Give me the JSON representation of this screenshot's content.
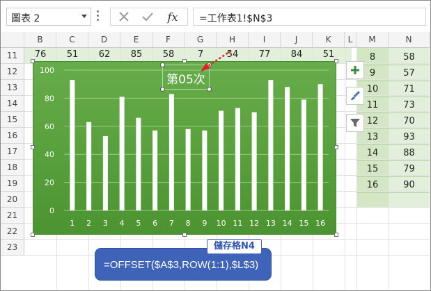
{
  "name_box": {
    "value": "圖表 2"
  },
  "formula_bar": {
    "fx_label": "fx",
    "formula": "=工作表1!$N$3"
  },
  "columns": [
    "B",
    "C",
    "D",
    "E",
    "F",
    "G",
    "H",
    "I",
    "J",
    "K",
    "L",
    "M",
    "N"
  ],
  "rows": [
    "11",
    "12",
    "13",
    "14",
    "15",
    "16",
    "17",
    "18",
    "19",
    "20",
    "21",
    "22",
    "23"
  ],
  "row10_partial": [
    "76",
    "51",
    "62",
    "85",
    "58",
    "7",
    "54",
    "77",
    "84",
    "51"
  ],
  "mn_table": [
    {
      "m": "8",
      "n": "58"
    },
    {
      "m": "9",
      "n": "57"
    },
    {
      "m": "10",
      "n": "71"
    },
    {
      "m": "11",
      "n": "73"
    },
    {
      "m": "12",
      "n": "70"
    },
    {
      "m": "13",
      "n": "93"
    },
    {
      "m": "14",
      "n": "88"
    },
    {
      "m": "15",
      "n": "79"
    },
    {
      "m": "16",
      "n": "90"
    }
  ],
  "chart_data": {
    "type": "bar",
    "title": "第05次",
    "categories": [
      "1",
      "2",
      "3",
      "4",
      "5",
      "6",
      "7",
      "8",
      "9",
      "10",
      "11",
      "12",
      "13",
      "14",
      "15",
      "16"
    ],
    "values": [
      93,
      63,
      53,
      81,
      66,
      57,
      83,
      58,
      57,
      71,
      73,
      70,
      93,
      88,
      79,
      90
    ],
    "yticks": [
      "0",
      "20",
      "40",
      "60",
      "80",
      "100"
    ],
    "ylim": [
      0,
      100
    ],
    "grid": true,
    "legend": "none",
    "bar_color": "#ffffff",
    "bg_color": "#5ba140"
  },
  "callout": {
    "tag": "儲存格N4",
    "formula": "=OFFSET($A$3,ROW(1:1),$L$3)"
  }
}
